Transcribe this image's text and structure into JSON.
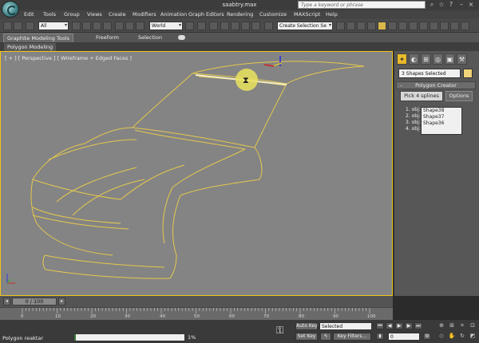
{
  "window": {
    "title": "saabtry.max",
    "search_placeholder": "Type a keyword or phrase"
  },
  "menu": [
    "Edit",
    "Tools",
    "Group",
    "Views",
    "Create",
    "Modifiers",
    "Animation",
    "Graph Editors",
    "Rendering",
    "Customize",
    "MAXScript",
    "Help"
  ],
  "toolbar": {
    "filter_select": "All",
    "coord_select": "World",
    "selection_set": "Create Selection Se"
  },
  "ribbon": {
    "tabs": [
      "Graphite Modeling Tools",
      "Freeform",
      "Selection"
    ],
    "subtab": "Polygon Modeling"
  },
  "viewport": {
    "label": "[ + ] [ Perspective ] [ Wireframe + Edged Faces ]",
    "wire_color": "#e5c84e",
    "border_color": "#f2c419"
  },
  "command_panel": {
    "selection_field": "3 Shapes Selected",
    "rollout_title": "Polygon Creator",
    "pick_button": "Pick 4 splines",
    "options_button": "Options",
    "object_labels": [
      "1. obj:",
      "2. obj:",
      "3. obj:",
      "4. obj:"
    ],
    "object_values": [
      "Shape38",
      "Shape37",
      "Shape36",
      ""
    ]
  },
  "timeline": {
    "slider_label": "0 / 100",
    "ticks": [
      "0",
      "10",
      "20",
      "30",
      "40",
      "50",
      "60",
      "70",
      "80",
      "90",
      "100"
    ]
  },
  "status": {
    "message": "Polygon reaktar",
    "progress_percent": 1,
    "progress_label": "1%",
    "auto_key": "Auto Key",
    "set_key": "Set Key",
    "key_select": "Selected",
    "key_filters": "Key Filters...",
    "frame": "0"
  }
}
